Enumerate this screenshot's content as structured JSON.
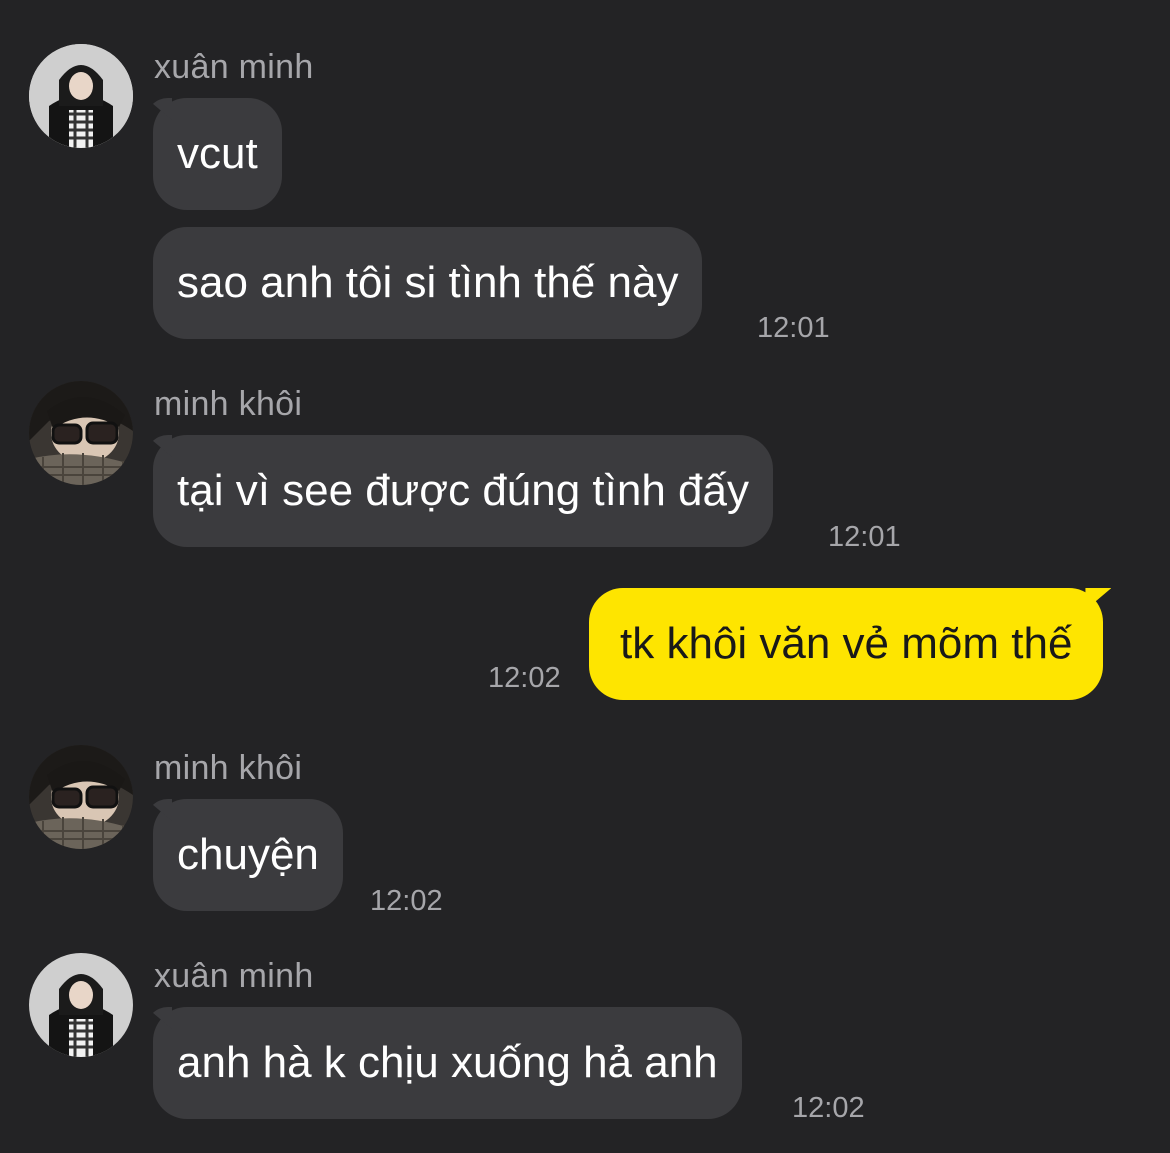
{
  "messages": [
    {
      "sender": "xuân minh",
      "text": "vcut"
    },
    {
      "text": "sao anh tôi si tình thế này",
      "time": "12:01"
    },
    {
      "sender": "minh khôi",
      "text": "tại vì see được đúng tình đấy",
      "time": "12:01"
    },
    {
      "text": "tk khôi văn vẻ mõm thế",
      "time": "12:02",
      "outgoing": true
    },
    {
      "sender": "minh khôi",
      "text": "chuyện",
      "time": "12:02"
    },
    {
      "sender": "xuân minh",
      "text": "anh hà k chịu xuống hả anh",
      "time": "12:02"
    }
  ],
  "colors": {
    "background": "#232325",
    "incoming_bubble": "#3b3b3e",
    "outgoing_bubble": "#fee500",
    "meta_text": "#a6a6aa"
  }
}
